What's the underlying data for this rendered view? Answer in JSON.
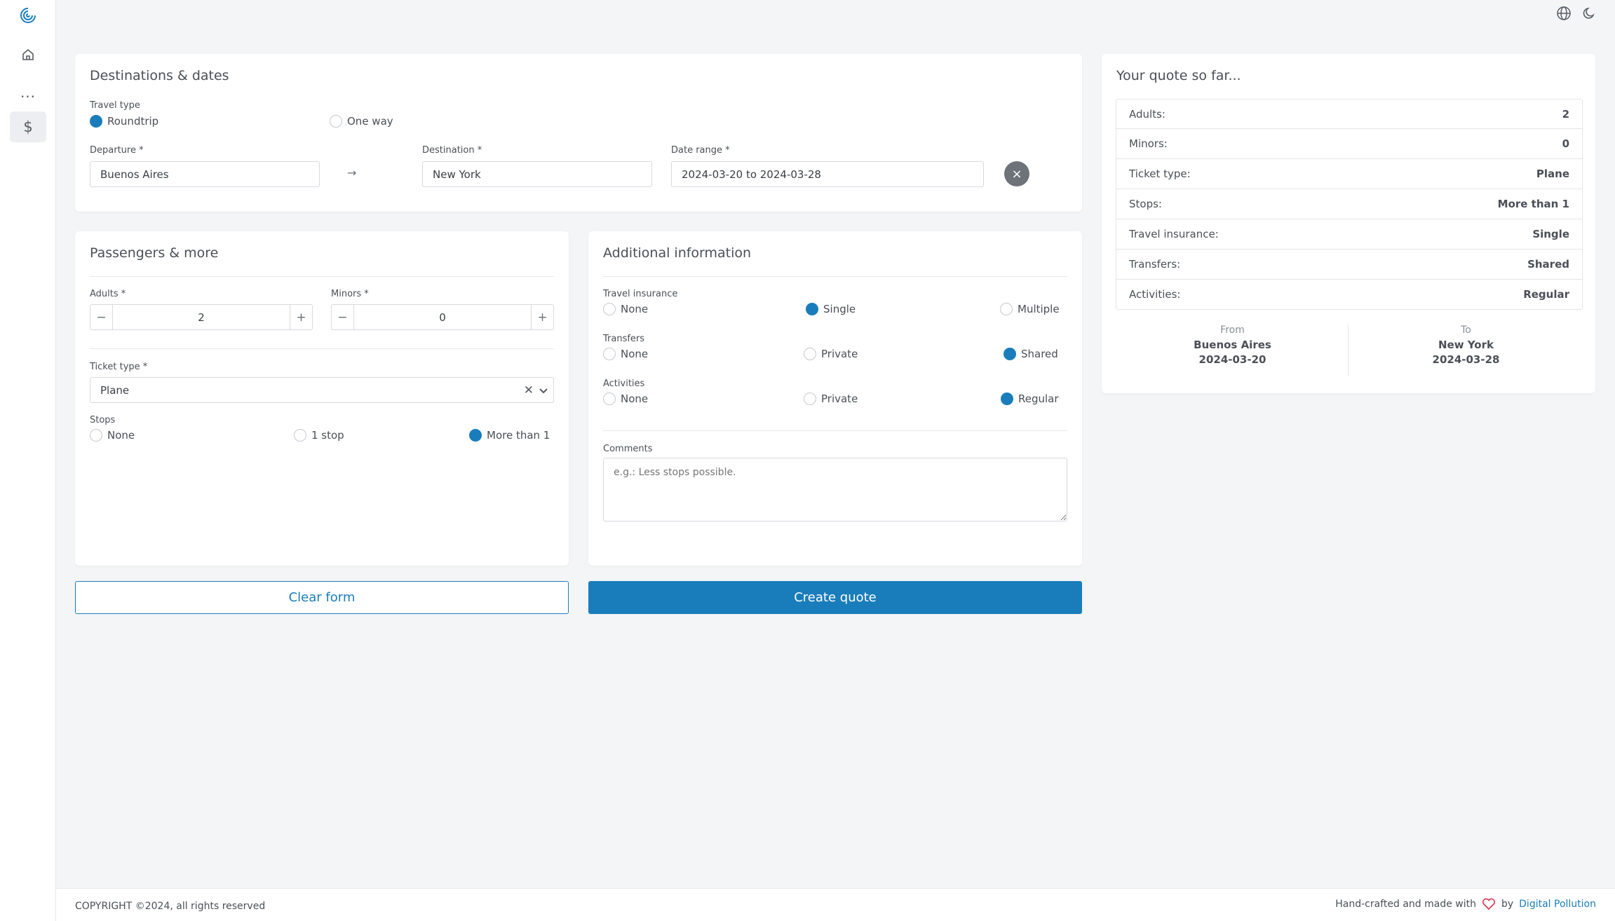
{
  "colors": {
    "accent": "#1a7dbb",
    "heart": "#d9304f"
  },
  "sidebar": {
    "icons": [
      "logo-icon",
      "home-icon",
      "more-icon",
      "dollar-icon"
    ],
    "more_glyph": "···",
    "dollar_glyph": "$"
  },
  "topbar": {
    "icons": [
      "globe-icon",
      "moon-icon"
    ]
  },
  "destinations": {
    "title": "Destinations & dates",
    "travel_type_label": "Travel type",
    "travel_type_options": [
      {
        "label": "Roundtrip",
        "checked": true
      },
      {
        "label": "One way",
        "checked": false
      }
    ],
    "departure_label": "Departure *",
    "departure_value": "Buenos Aires",
    "arrow_glyph": "→",
    "destination_label": "Destination *",
    "destination_value": "New York",
    "date_range_label": "Date range *",
    "date_range_value": "2024-03-20 to 2024-03-28",
    "clear_glyph": "×"
  },
  "passengers": {
    "title": "Passengers & more",
    "adults_label": "Adults *",
    "adults_value": "2",
    "minors_label": "Minors *",
    "minors_value": "0",
    "minus_glyph": "−",
    "plus_glyph": "+",
    "ticket_type_label": "Ticket type *",
    "ticket_type_value": "Plane",
    "stops_label": "Stops",
    "stops_options": [
      {
        "label": "None",
        "checked": false
      },
      {
        "label": "1 stop",
        "checked": false
      },
      {
        "label": "More than 1",
        "checked": true
      }
    ]
  },
  "additional": {
    "title": "Additional information",
    "insurance_label": "Travel insurance",
    "insurance_options": [
      {
        "label": "None",
        "checked": false
      },
      {
        "label": "Single",
        "checked": true
      },
      {
        "label": "Multiple",
        "checked": false
      }
    ],
    "transfers_label": "Transfers",
    "transfers_options": [
      {
        "label": "None",
        "checked": false
      },
      {
        "label": "Private",
        "checked": false
      },
      {
        "label": "Shared",
        "checked": true
      }
    ],
    "activities_label": "Activities",
    "activities_options": [
      {
        "label": "None",
        "checked": false
      },
      {
        "label": "Private",
        "checked": false
      },
      {
        "label": "Regular",
        "checked": true
      }
    ],
    "comments_label": "Comments",
    "comments_placeholder": "e.g.: Less stops possible."
  },
  "actions": {
    "clear_label": "Clear form",
    "create_label": "Create quote"
  },
  "quote": {
    "title": "Your quote so far...",
    "rows": [
      {
        "label": "Adults:",
        "value": "2"
      },
      {
        "label": "Minors:",
        "value": "0"
      },
      {
        "label": "Ticket type:",
        "value": "Plane"
      },
      {
        "label": "Stops:",
        "value": "More than 1"
      },
      {
        "label": "Travel insurance:",
        "value": "Single"
      },
      {
        "label": "Transfers:",
        "value": "Shared"
      },
      {
        "label": "Activities:",
        "value": "Regular"
      }
    ],
    "from_label": "From",
    "from_city": "Buenos Aires",
    "from_date": "2024-03-20",
    "to_label": "To",
    "to_city": "New York",
    "to_date": "2024-03-28"
  },
  "footer": {
    "copyright": "COPYRIGHT ©2024, all rights reserved",
    "made_with": "Hand-crafted and made with",
    "by": "by",
    "company": "Digital Pollution"
  }
}
